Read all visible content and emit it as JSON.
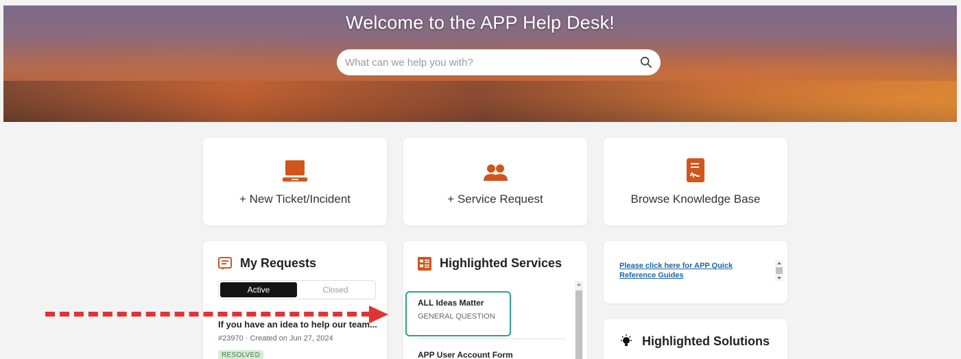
{
  "hero": {
    "title": "Welcome to the APP Help Desk!",
    "search_placeholder": "What can we help you with?"
  },
  "actions": [
    {
      "label": "+ New Ticket/Incident",
      "icon": "laptop-icon"
    },
    {
      "label": "+ Service Request",
      "icon": "users-icon"
    },
    {
      "label": "Browse Knowledge Base",
      "icon": "document-icon"
    }
  ],
  "my_requests": {
    "title": "My Requests",
    "tabs": {
      "active": "Active",
      "closed": "Closed"
    },
    "items": [
      {
        "title": "If you have an idea to help our team...",
        "meta": "#23970 · Created on Jun 27, 2024",
        "status": "RESOLVED"
      }
    ]
  },
  "highlighted_services": {
    "title": "Highlighted Services",
    "items": [
      {
        "title": "ALL Ideas Matter",
        "category": "GENERAL QUESTION"
      },
      {
        "title": "APP User Account Form",
        "category": ""
      }
    ]
  },
  "quick_ref": {
    "link_text": "Please click here for APP Quick Reference Guides"
  },
  "highlighted_solutions": {
    "title": "Highlighted Solutions"
  },
  "colors": {
    "accent": "#d0561b",
    "highlight_border": "#27a38b",
    "annotation_arrow": "#e03434"
  }
}
